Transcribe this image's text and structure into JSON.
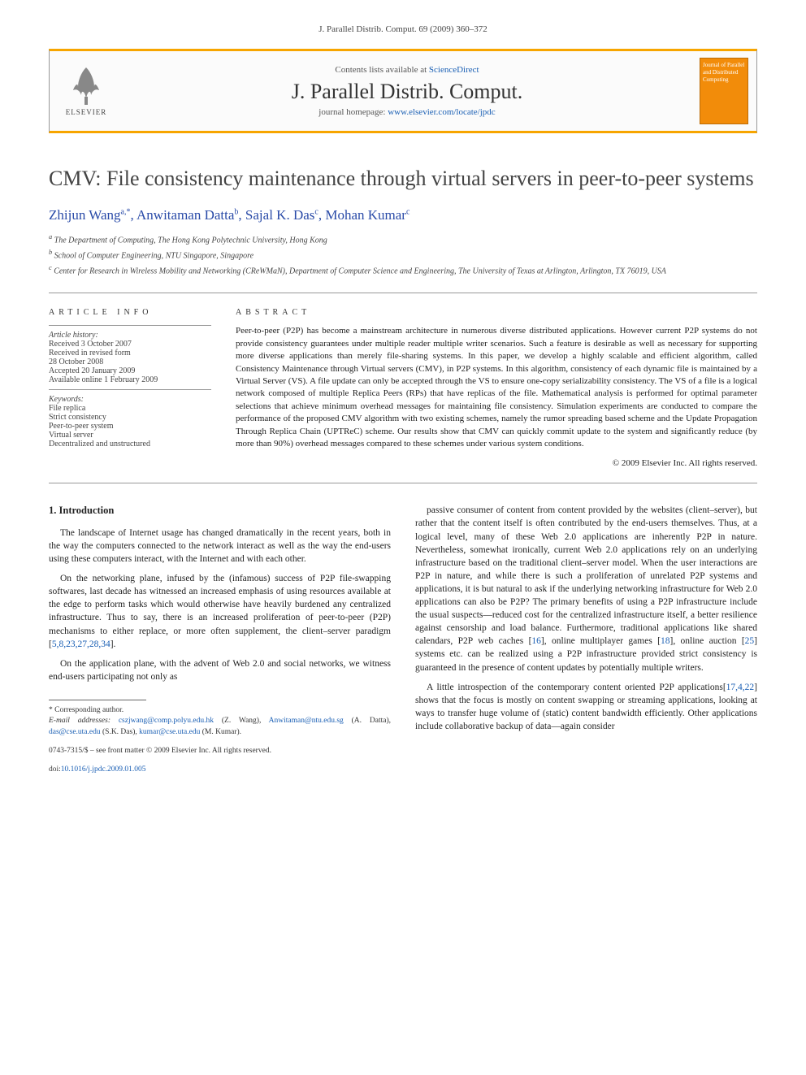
{
  "header": {
    "citation": "J. Parallel Distrib. Comput. 69 (2009) 360–372"
  },
  "banner": {
    "publisher": "ELSEVIER",
    "contents_prefix": "Contents lists available at ",
    "contents_link": "ScienceDirect",
    "journal": "J. Parallel Distrib. Comput.",
    "homepage_prefix": "journal homepage: ",
    "homepage_link": "www.elsevier.com/locate/jpdc",
    "cover_text": "Journal of Parallel and Distributed Computing"
  },
  "article": {
    "title": "CMV: File consistency maintenance through virtual servers in peer-to-peer systems",
    "authors_html": "Zhijun Wang<sup>a,*</sup>, Anwitaman Datta<sup>b</sup>, Sajal K. Das<sup>c</sup>, Mohan Kumar<sup>c</sup>",
    "affiliations": [
      "a The Department of Computing, The Hong Kong Polytechnic University, Hong Kong",
      "b School of Computer Engineering, NTU Singapore, Singapore",
      "c Center for Research in Wireless Mobility and Networking (CReWMaN), Department of Computer Science and Engineering, The University of Texas at Arlington, Arlington, TX 76019, USA"
    ]
  },
  "info": {
    "heading": "ARTICLE INFO",
    "history_label": "Article history:",
    "history": [
      "Received 3 October 2007",
      "Received in revised form",
      "28 October 2008",
      "Accepted 20 January 2009",
      "Available online 1 February 2009"
    ],
    "keywords_label": "Keywords:",
    "keywords": [
      "File replica",
      "Strict consistency",
      "Peer-to-peer system",
      "Virtual server",
      "Decentralized and unstructured"
    ]
  },
  "abstract": {
    "heading": "ABSTRACT",
    "body": "Peer-to-peer (P2P) has become a mainstream architecture in numerous diverse distributed applications. However current P2P systems do not provide consistency guarantees under multiple reader multiple writer scenarios. Such a feature is desirable as well as necessary for supporting more diverse applications than merely file-sharing systems. In this paper, we develop a highly scalable and efficient algorithm, called Consistency Maintenance through Virtual servers (CMV), in P2P systems. In this algorithm, consistency of each dynamic file is maintained by a Virtual Server (VS). A file update can only be accepted through the VS to ensure one-copy serializability consistency. The VS of a file is a logical network composed of multiple Replica Peers (RPs) that have replicas of the file. Mathematical analysis is performed for optimal parameter selections that achieve minimum overhead messages for maintaining file consistency. Simulation experiments are conducted to compare the performance of the proposed CMV algorithm with two existing schemes, namely the rumor spreading based scheme and the Update Propagation Through Replica Chain (UPTReC) scheme. Our results show that CMV can quickly commit update to the system and significantly reduce (by more than 90%) overhead messages compared to these schemes under various system conditions.",
    "copyright": "© 2009 Elsevier Inc. All rights reserved."
  },
  "body": {
    "section1_heading": "1. Introduction",
    "left_paras": [
      "The landscape of Internet usage has changed dramatically in the recent years, both in the way the computers connected to the network interact as well as the way the end-users using these computers interact, with the Internet and with each other.",
      "On the networking plane, infused by the (infamous) success of P2P file-swapping softwares, last decade has witnessed an increased emphasis of using resources available at the edge to perform tasks which would otherwise have heavily burdened any centralized infrastructure. Thus to say, there is an increased proliferation of peer-to-peer (P2P) mechanisms to either replace, or more often supplement, the client–server paradigm [5,8,23,27,28,34].",
      "On the application plane, with the advent of Web 2.0 and social networks, we witness end-users participating not only as"
    ],
    "right_paras": [
      "passive consumer of content from content provided by the websites (client–server), but rather that the content itself is often contributed by the end-users themselves. Thus, at a logical level, many of these Web 2.0 applications are inherently P2P in nature. Nevertheless, somewhat ironically, current Web 2.0 applications rely on an underlying infrastructure based on the traditional client–server model. When the user interactions are P2P in nature, and while there is such a proliferation of unrelated P2P systems and applications, it is but natural to ask if the underlying networking infrastructure for Web 2.0 applications can also be P2P? The primary benefits of using a P2P infrastructure include the usual suspects—reduced cost for the centralized infrastructure itself, a better resilience against censorship and load balance. Furthermore, traditional applications like shared calendars, P2P web caches [16], online multiplayer games [18], online auction [25] systems etc. can be realized using a P2P infrastructure provided strict consistency is guaranteed in the presence of content updates by potentially multiple writers.",
      "A little introspection of the contemporary content oriented P2P applications[17,4,22] shows that the focus is mostly on content swapping or streaming applications, looking at ways to transfer huge volume of (static) content bandwidth efficiently. Other applications include collaborative backup of data—again consider"
    ]
  },
  "footnotes": {
    "corr": "* Corresponding author.",
    "emails_label": "E-mail addresses:",
    "emails": [
      {
        "addr": "cszjwang@comp.polyu.edu.hk",
        "who": "(Z. Wang),"
      },
      {
        "addr": "Anwitaman@ntu.edu.sg",
        "who": "(A. Datta),"
      },
      {
        "addr": "das@cse.uta.edu",
        "who": "(S.K. Das),"
      },
      {
        "addr": "kumar@cse.uta.edu",
        "who": "(M. Kumar)."
      }
    ]
  },
  "footer": {
    "line1": "0743-7315/$ – see front matter © 2009 Elsevier Inc. All rights reserved.",
    "doi_label": "doi:",
    "doi": "10.1016/j.jpdc.2009.01.005"
  }
}
